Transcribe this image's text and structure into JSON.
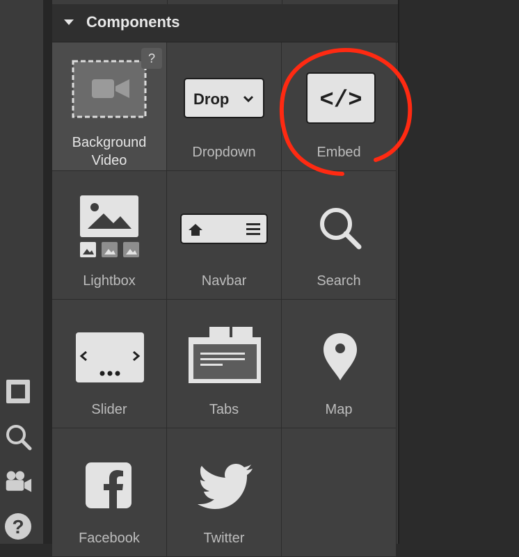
{
  "panel": {
    "section_title": "Components",
    "help_label": "?"
  },
  "components": [
    {
      "name": "Background Video",
      "line1": "Background",
      "line2": "Video",
      "icon": "video-camera-icon"
    },
    {
      "name": "Dropdown",
      "icon_text": "Drop",
      "icon": "dropdown-icon"
    },
    {
      "name": "Embed",
      "icon_text": "</>",
      "icon": "code-icon"
    },
    {
      "name": "Lightbox",
      "icon": "image-gallery-icon"
    },
    {
      "name": "Navbar",
      "icon": "navbar-icon"
    },
    {
      "name": "Search",
      "icon": "search-icon"
    },
    {
      "name": "Slider",
      "icon": "slider-icon"
    },
    {
      "name": "Tabs",
      "icon": "tabs-icon"
    },
    {
      "name": "Map",
      "icon": "map-pin-icon"
    },
    {
      "name": "Facebook",
      "icon": "facebook-icon"
    },
    {
      "name": "Twitter",
      "icon": "twitter-icon"
    }
  ],
  "rail": {
    "icons": [
      "square-icon",
      "search-icon",
      "video-camera-icon",
      "help-icon"
    ],
    "help_glyph": "?"
  },
  "colors": {
    "annotation": "#ff2a12",
    "panel": "#3d3d3d",
    "highlight_cell": "#4c4c4c"
  }
}
